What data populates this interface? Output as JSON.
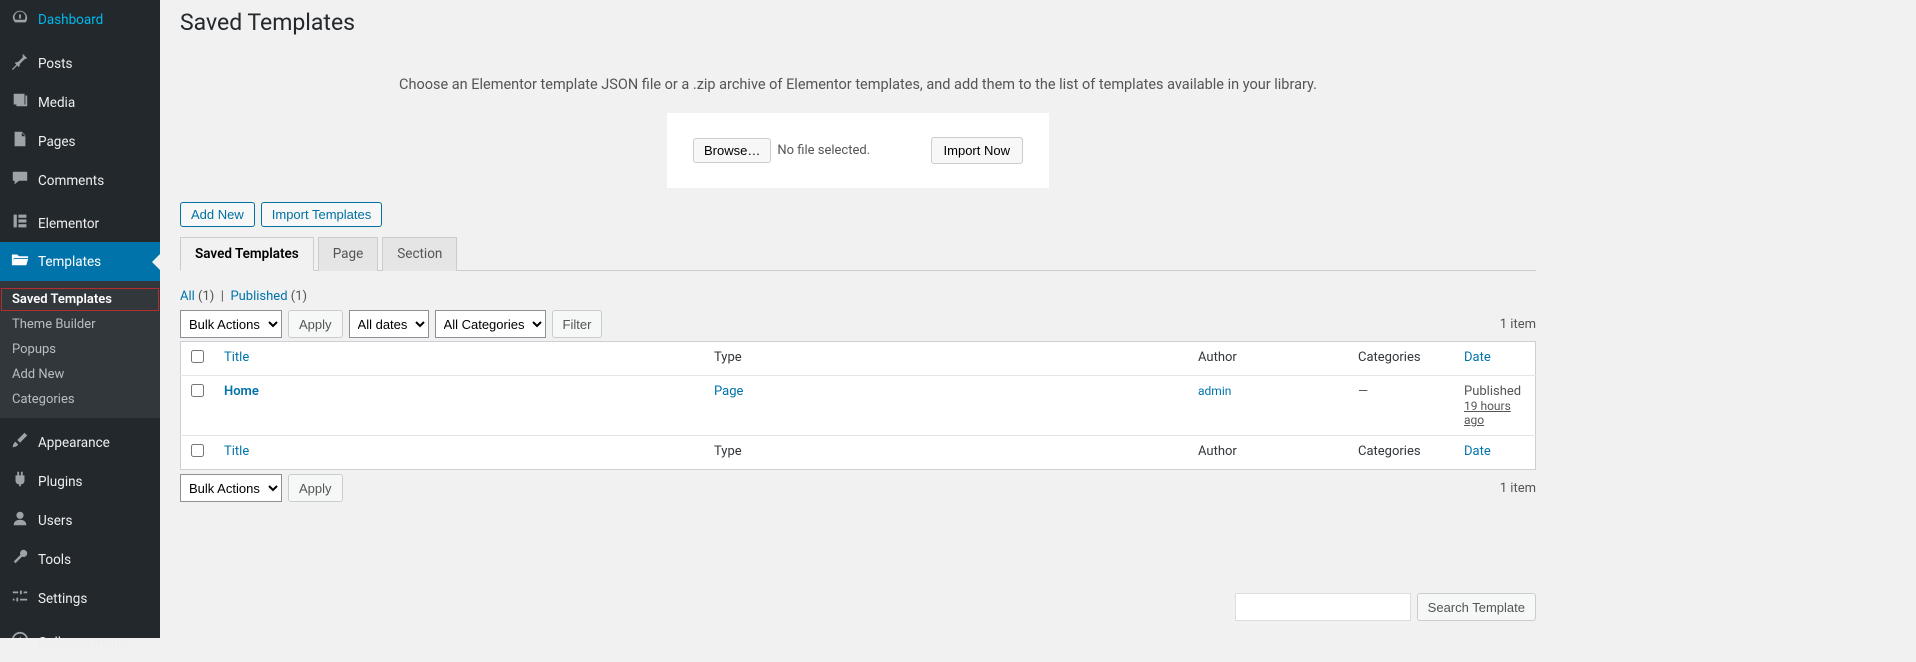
{
  "sidebar": {
    "items": [
      {
        "label": "Dashboard"
      },
      {
        "label": "Posts"
      },
      {
        "label": "Media"
      },
      {
        "label": "Pages"
      },
      {
        "label": "Comments"
      },
      {
        "label": "Elementor"
      },
      {
        "label": "Templates"
      },
      {
        "label": "Appearance"
      },
      {
        "label": "Plugins"
      },
      {
        "label": "Users"
      },
      {
        "label": "Tools"
      },
      {
        "label": "Settings"
      },
      {
        "label": "Collapse menu"
      }
    ],
    "submenu": [
      {
        "label": "Saved Templates"
      },
      {
        "label": "Theme Builder"
      },
      {
        "label": "Popups"
      },
      {
        "label": "Add New"
      },
      {
        "label": "Categories"
      }
    ]
  },
  "page": {
    "title": "Saved Templates",
    "import_description": "Choose an Elementor template JSON file or a .zip archive of Elementor templates, and add them to the list of templates available in your library.",
    "browse_label": "Browse…",
    "no_file": "No file selected.",
    "import_now": "Import Now",
    "add_new": "Add New",
    "import_templates": "Import Templates",
    "tabs": [
      {
        "label": "Saved Templates"
      },
      {
        "label": "Page"
      },
      {
        "label": "Section"
      }
    ],
    "subsub": {
      "all_label": "All",
      "all_count": "(1)",
      "sep": "|",
      "pub_label": "Published",
      "pub_count": "(1)"
    },
    "search_btn": "Search Template",
    "bulk_actions": "Bulk Actions",
    "all_dates": "All dates",
    "all_categories": "All Categories",
    "apply": "Apply",
    "filter": "Filter",
    "item_count": "1 item",
    "headers": {
      "title": "Title",
      "type": "Type",
      "author": "Author",
      "categories": "Categories",
      "date": "Date"
    },
    "rows": [
      {
        "title": "Home",
        "type": "Page",
        "author": "admin",
        "categories": "—",
        "date_status": "Published",
        "date_rel": "19 hours ago"
      }
    ]
  }
}
